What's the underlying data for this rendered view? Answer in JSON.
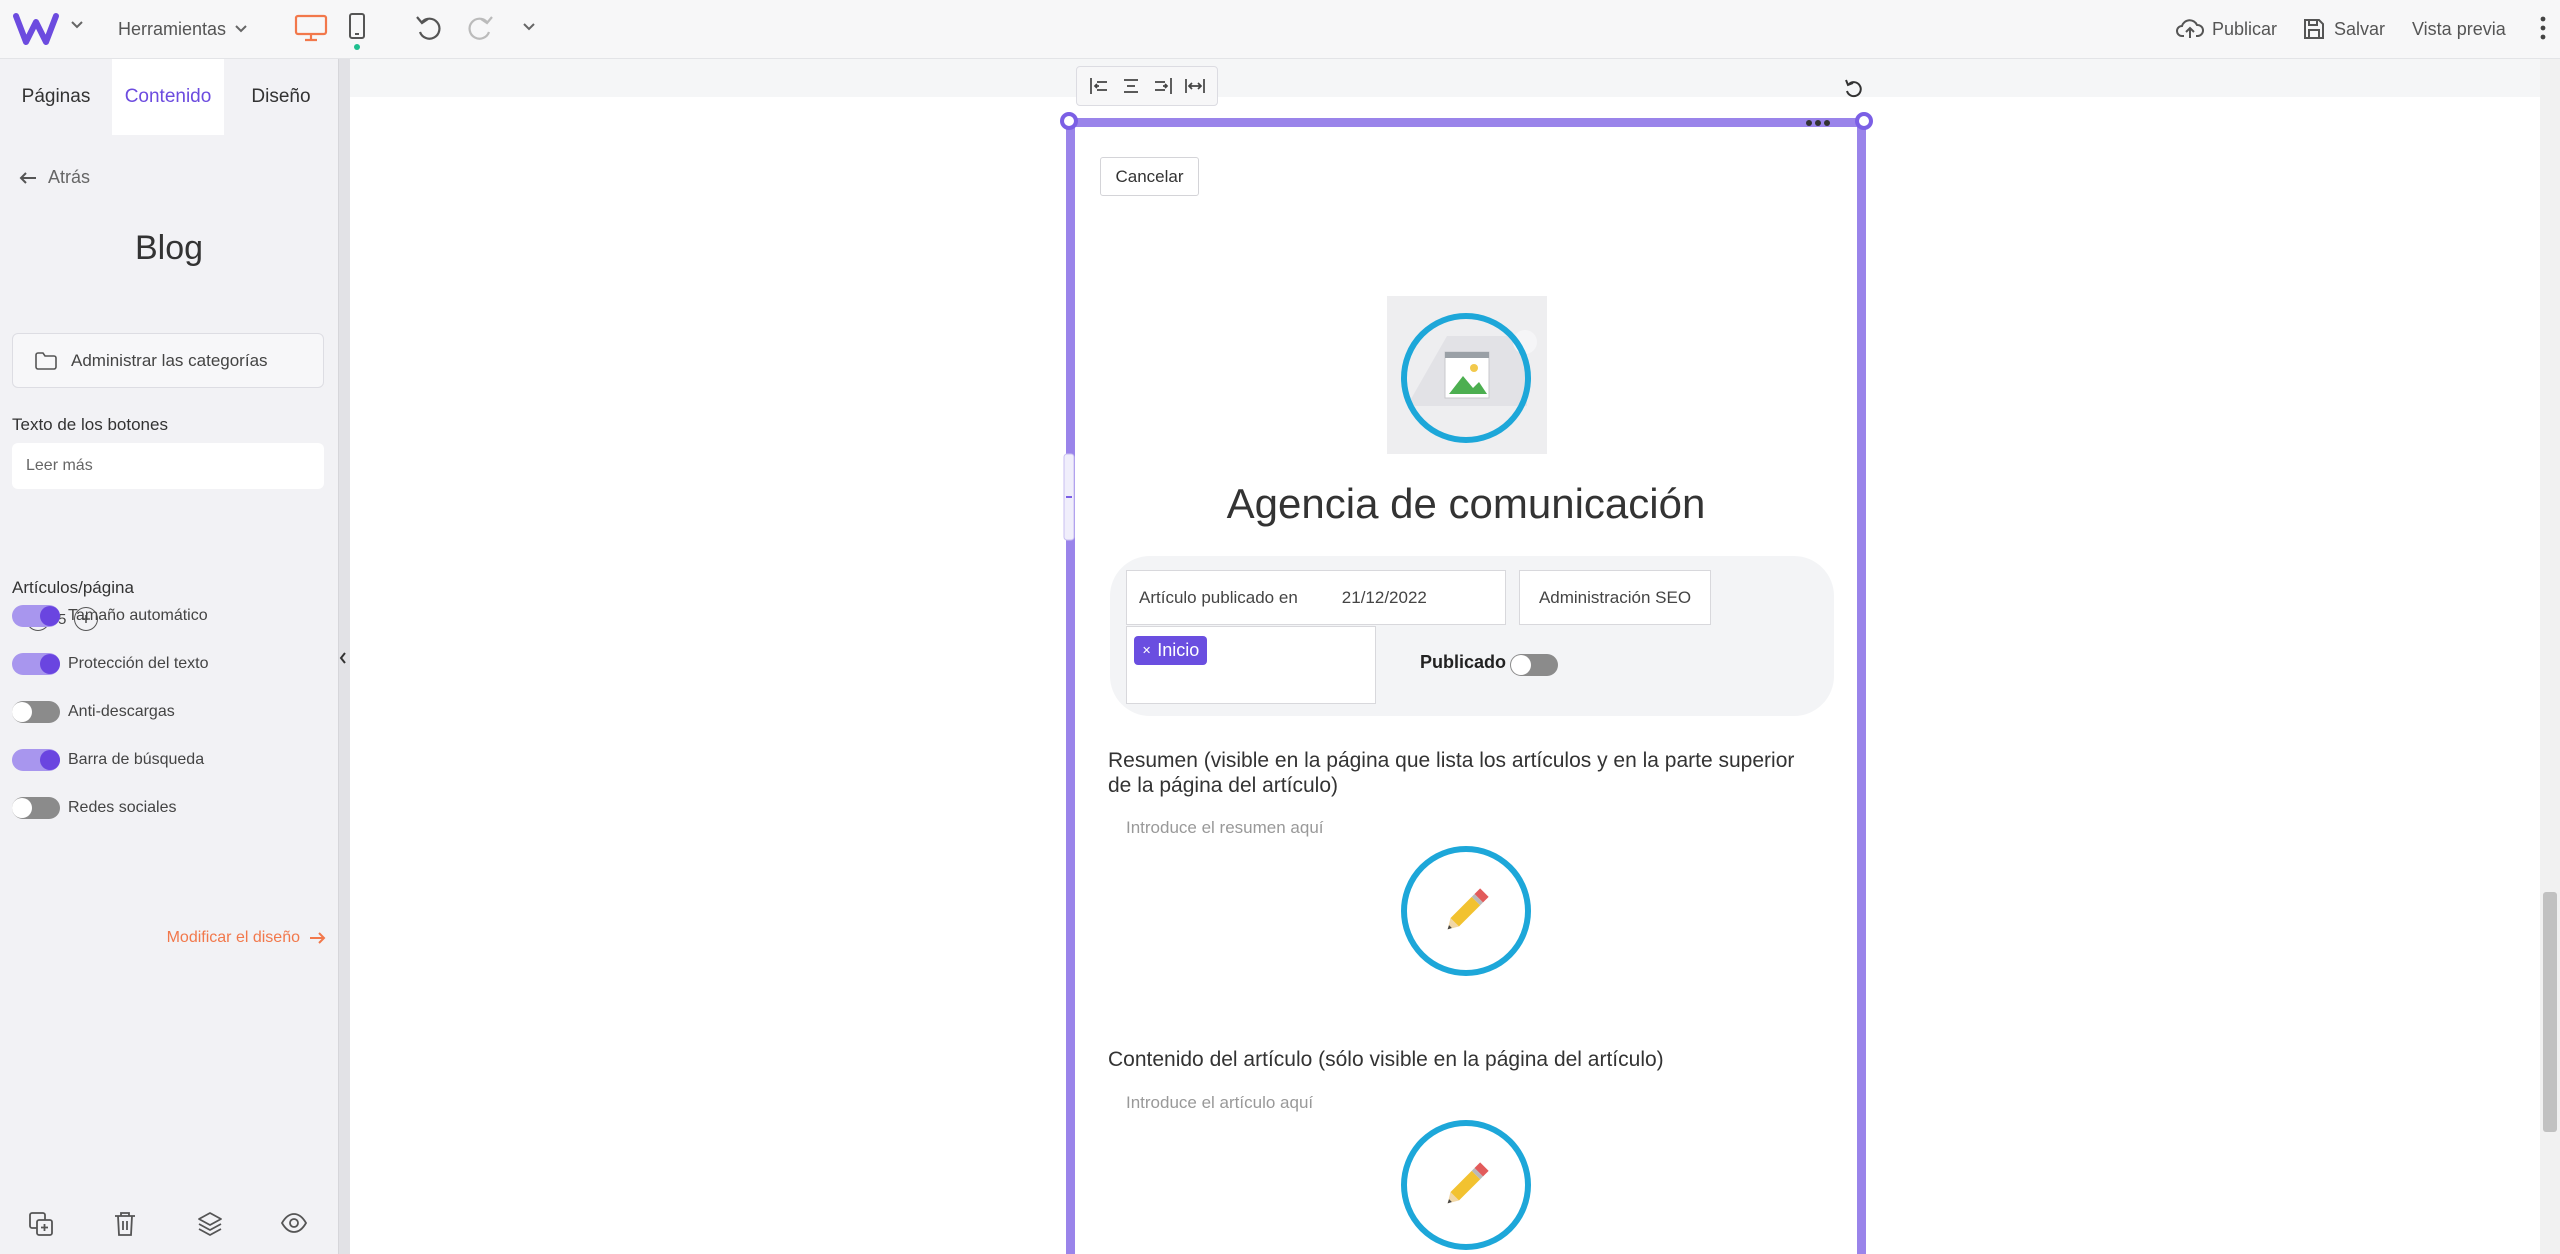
{
  "topbar": {
    "tools_label": "Herramientas",
    "publish_label": "Publicar",
    "save_label": "Salvar",
    "preview_label": "Vista previa"
  },
  "panel": {
    "tabs": [
      {
        "label": "Páginas",
        "active": false
      },
      {
        "label": "Contenido",
        "active": true
      },
      {
        "label": "Diseño",
        "active": false
      }
    ],
    "back_label": "Atrás",
    "title": "Blog",
    "categories_button": "Administrar las categorías",
    "buttons_text_label": "Texto de los botones",
    "buttons_text_value": "Leer más",
    "articles_per_page_label": "Artículos/página",
    "articles_per_page_value": "5",
    "toggles": [
      {
        "label": "Tamaño automático",
        "on": true
      },
      {
        "label": "Protección del texto",
        "on": true
      },
      {
        "label": "Anti-descargas",
        "on": false
      },
      {
        "label": "Barra de búsqueda",
        "on": true
      },
      {
        "label": "Redes sociales",
        "on": false
      }
    ],
    "modify_design_label": "Modificar el diseño"
  },
  "editor": {
    "cancel_label": "Cancelar",
    "post_title": "Agencia de comunicación",
    "published_in_label": "Artículo publicado en",
    "date_value": "21/12/2022",
    "seo_label": "Administración SEO",
    "category_tag": "Inicio",
    "published_label": "Publicado",
    "published_on": false,
    "summary_label": "Resumen (visible en la página que lista los artículos y en la parte superior de la página del artículo)",
    "summary_placeholder": "Introduce el resumen aquí",
    "content_label": "Contenido del artículo (sólo visible en la página del artículo)",
    "content_placeholder": "Introduce el artículo aquí"
  },
  "colors": {
    "accent": "#6c4bdf",
    "frame": "#9a84ea",
    "device_active": "#f2784b",
    "link": "#f2784b",
    "ring": "#1da7d9"
  }
}
